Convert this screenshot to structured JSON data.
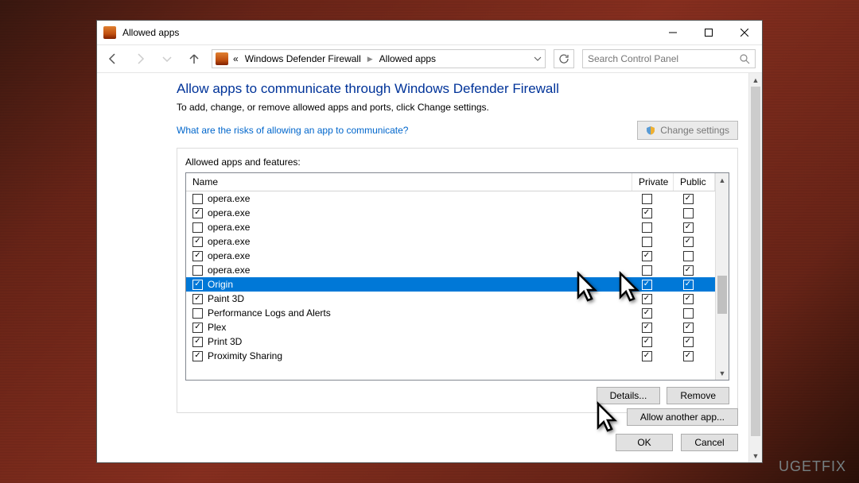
{
  "window": {
    "title": "Allowed apps"
  },
  "toolbar": {
    "breadcrumb": {
      "prefix": "«",
      "part1": "Windows Defender Firewall",
      "part2": "Allowed apps"
    },
    "search_placeholder": "Search Control Panel"
  },
  "page": {
    "title": "Allow apps to communicate through Windows Defender Firewall",
    "subtitle": "To add, change, or remove allowed apps and ports, click Change settings.",
    "risk_link": "What are the risks of allowing an app to communicate?",
    "change_settings": "Change settings",
    "group_label": "Allowed apps and features:",
    "col_name": "Name",
    "col_private": "Private",
    "col_public": "Public",
    "details": "Details...",
    "remove": "Remove",
    "allow_another": "Allow another app...",
    "ok": "OK",
    "cancel": "Cancel"
  },
  "rows": [
    {
      "enabled": false,
      "name": "opera.exe",
      "private": false,
      "public": true,
      "selected": false
    },
    {
      "enabled": true,
      "name": "opera.exe",
      "private": true,
      "public": false,
      "selected": false
    },
    {
      "enabled": false,
      "name": "opera.exe",
      "private": false,
      "public": true,
      "selected": false
    },
    {
      "enabled": true,
      "name": "opera.exe",
      "private": false,
      "public": true,
      "selected": false
    },
    {
      "enabled": true,
      "name": "opera.exe",
      "private": true,
      "public": false,
      "selected": false
    },
    {
      "enabled": false,
      "name": "opera.exe",
      "private": false,
      "public": true,
      "selected": false
    },
    {
      "enabled": true,
      "name": "Origin",
      "private": true,
      "public": true,
      "selected": true
    },
    {
      "enabled": true,
      "name": "Paint 3D",
      "private": true,
      "public": true,
      "selected": false
    },
    {
      "enabled": false,
      "name": "Performance Logs and Alerts",
      "private": true,
      "public": false,
      "selected": false
    },
    {
      "enabled": true,
      "name": "Plex",
      "private": true,
      "public": true,
      "selected": false
    },
    {
      "enabled": true,
      "name": "Print 3D",
      "private": true,
      "public": true,
      "selected": false
    },
    {
      "enabled": true,
      "name": "Proximity Sharing",
      "private": true,
      "public": true,
      "selected": false
    }
  ],
  "watermark": "UGETFIX"
}
